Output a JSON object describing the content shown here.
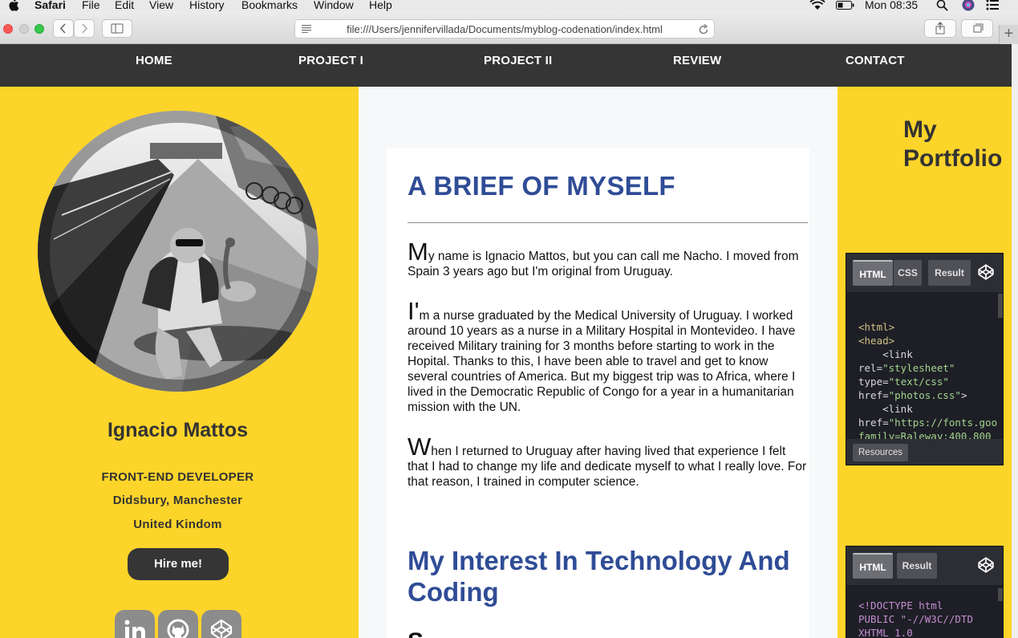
{
  "menubar": {
    "app": "Safari",
    "items": [
      "File",
      "Edit",
      "View",
      "History",
      "Bookmarks",
      "Window",
      "Help"
    ],
    "clock": "Mon 08:35"
  },
  "browser": {
    "url": "file:///Users/jennifervillada/Documents/myblog-codenation/index.html",
    "new_tab": "+"
  },
  "nav": [
    "HOME",
    "PROJECT I",
    "PROJECT II",
    "REVIEW",
    "CONTACT"
  ],
  "profile": {
    "name": "Ignacio Mattos",
    "role": "FRONT-END DEVELOPER",
    "location_line1": "Didsbury, Manchester",
    "location_line2": "United Kindom",
    "cta": "Hire me!",
    "social": [
      "linkedin-icon",
      "github-icon",
      "codepen-icon"
    ]
  },
  "article": {
    "title": "A BRIEF OF MYSELF",
    "paragraphs": [
      {
        "cap": "M",
        "text": "y name is Ignacio Mattos, but you can call me Nacho. I moved from Spain 3 years ago but I'm original from Uruguay."
      },
      {
        "cap": "I'",
        "text": "m a nurse graduated by the Medical University of Uruguay. I worked around 10 years as a nurse in a Military Hospital in Montevideo. I have received Military training for 3 months before starting to work in the Hopital. Thanks to this, I have been able to travel and get to know several countries of America. But my biggest trip was to Africa, where I lived in the Democratic Republic of Congo for a year in a humanitarian mission with the UN."
      },
      {
        "cap": "W",
        "text": "hen I returned to Uruguay after having lived that experience I felt that I had to change my life and dedicate myself to what I really love. For that reason, I trained in computer science."
      }
    ],
    "subtitle": "My Interest In Technology And Coding",
    "partial_cap": "S"
  },
  "portfolio": {
    "title_line1": "My",
    "title_line2": "Portfolio",
    "embed1": {
      "tabs": [
        "HTML",
        "CSS",
        "Result"
      ],
      "active": "HTML",
      "resources": "Resources"
    },
    "embed2": {
      "tabs": [
        "HTML",
        "Result"
      ],
      "active": "HTML"
    }
  },
  "colors": {
    "yellow": "#fdd42a",
    "dark": "#353535",
    "heading_blue": "#2f4c96"
  }
}
